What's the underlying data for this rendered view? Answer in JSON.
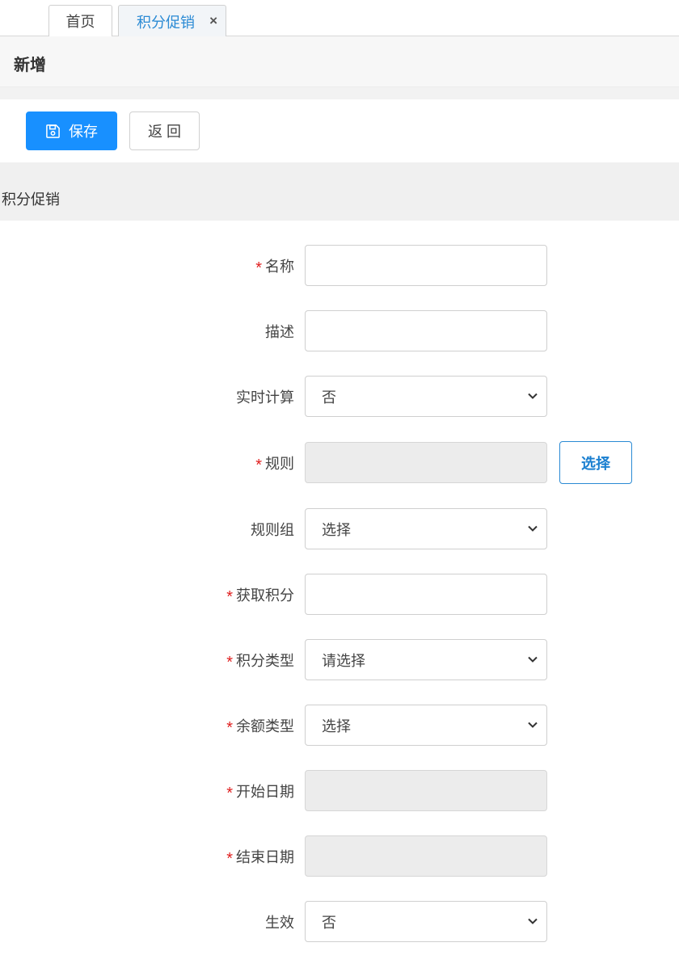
{
  "tabs": {
    "home_label": "首页",
    "active_label": "积分促销",
    "close_symbol": "×"
  },
  "page": {
    "title": "新增"
  },
  "toolbar": {
    "save_label": "保存",
    "back_label": "返 回"
  },
  "section": {
    "title": "积分促销"
  },
  "form": {
    "required_mark": "*",
    "name": {
      "label": "名称",
      "value": ""
    },
    "description": {
      "label": "描述",
      "value": ""
    },
    "realtime": {
      "label": "实时计算",
      "value": "否"
    },
    "rule": {
      "label": "规则",
      "value": "",
      "choose_label": "选择"
    },
    "rule_group": {
      "label": "规则组",
      "value": "选择"
    },
    "points": {
      "label": "获取积分",
      "value": ""
    },
    "points_type": {
      "label": "积分类型",
      "value": "请选择"
    },
    "balance_type": {
      "label": "余额类型",
      "value": "选择"
    },
    "start_date": {
      "label": "开始日期",
      "value": ""
    },
    "end_date": {
      "label": "结束日期",
      "value": ""
    },
    "effective": {
      "label": "生效",
      "value": "否"
    }
  },
  "colors": {
    "primary": "#1890ff",
    "required": "#e02020",
    "link": "#2a8ad4"
  }
}
